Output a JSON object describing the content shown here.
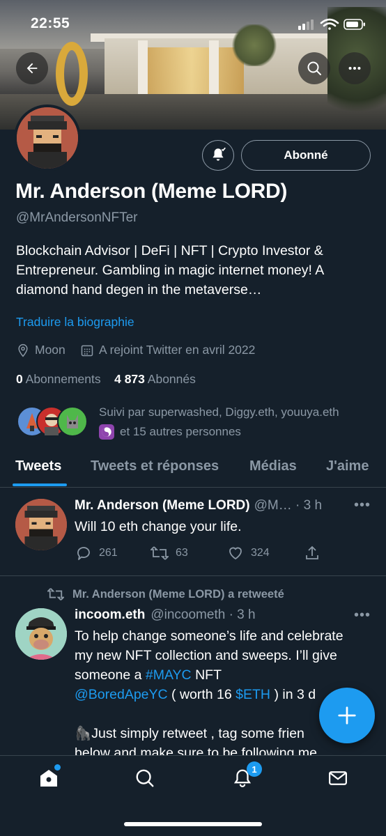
{
  "status_bar": {
    "time": "22:55"
  },
  "profile": {
    "follow_button": "Abonné",
    "name": "Mr. Anderson (Meme LORD)",
    "handle": "@MrAndersonNFTer",
    "bio": "Blockchain Advisor | DeFi | NFT | Crypto Investor & Entrepreneur. Gambling in magic internet money! A diamond hand degen in the metaverse…",
    "translate_link": "Traduire la biographie",
    "location": "Moon",
    "joined": "A rejoint Twitter en avril 2022",
    "following_count": "0",
    "following_label": "Abonnements",
    "followers_count": "4 873",
    "followers_label": "Abonnés",
    "followed_by_line1": "Suivi par superwashed, Diggy.eth, youuya.eth",
    "followed_by_line2": "et 15 autres personnes"
  },
  "tabs": [
    "Tweets",
    "Tweets et réponses",
    "Médias",
    "J'aime"
  ],
  "tweets": [
    {
      "name": "Mr. Anderson (Meme LORD)",
      "handle_time": "@M… · 3 h",
      "text": "Will 10 eth change your life.",
      "replies": "261",
      "retweets": "63",
      "likes": "324"
    },
    {
      "retweet_label": "Mr. Anderson (Meme LORD) a retweeté",
      "name": "incoom.eth",
      "handle_time": "@incoometh · 3 h",
      "text_a": "To help change someone’s life and celebrate my new NFT collection and sweeps. I’ll give someone a ",
      "hashtag": "#MAYC",
      "text_b": " NFT",
      "mention": "@BoredApeYC",
      "text_c": " ( worth 16 ",
      "cashtag": "$ETH",
      "text_d": " ) in 3 d",
      "text_e": "🦍Just simply retweet , tag some frien",
      "text_f": "below and make sure to be following me"
    }
  ],
  "bottom_nav": {
    "notifications_badge": "1"
  },
  "colors": {
    "background": "#15202b",
    "accent": "#1d9bf0",
    "secondary_text": "#8b98a5",
    "border": "#38444d"
  }
}
